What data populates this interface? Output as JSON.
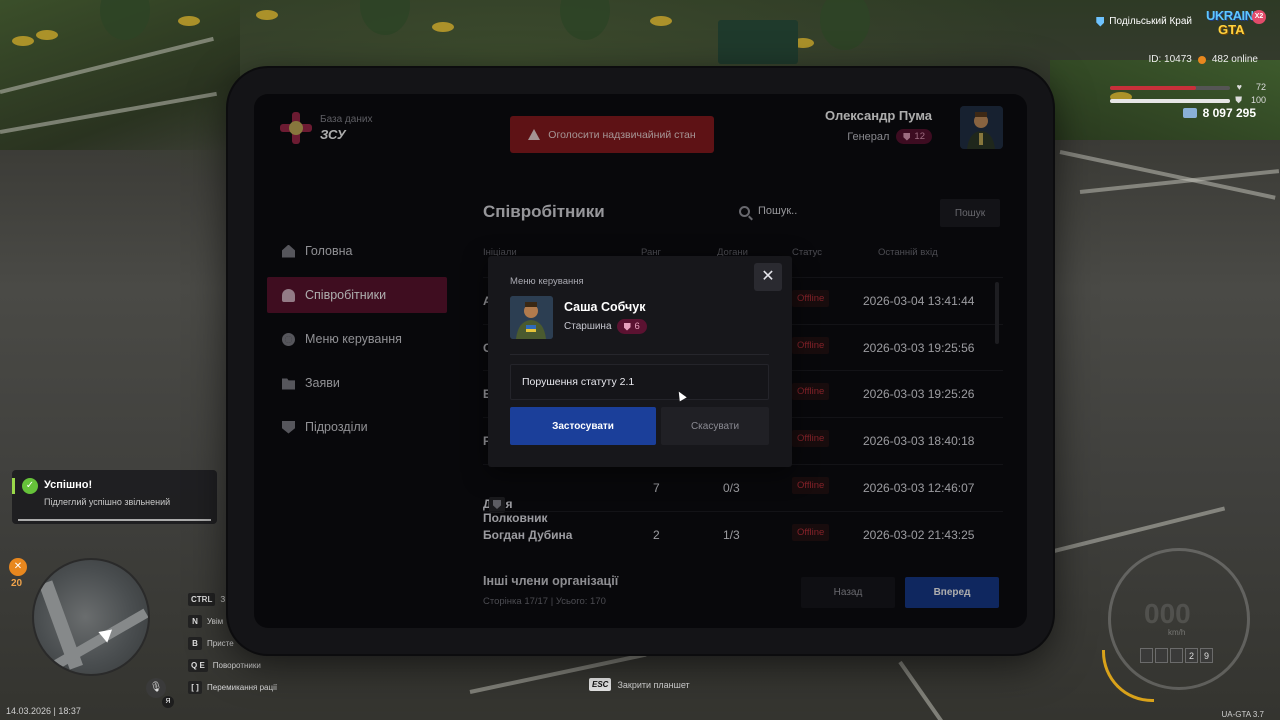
{
  "hud": {
    "region": "Подільський Край",
    "logo_line1": "UKRAINE",
    "logo_line2": "GTA",
    "logo_badge": "X2",
    "player_id": "ID: 10473",
    "online": "482 online",
    "health": 72,
    "armor": 100,
    "money": "8 097 295",
    "hunger": "20",
    "mic_key": "Я",
    "datetime": "14.03.2026 | 18:37",
    "version": "UA-GTA 3.7",
    "speed_unit": "km/h",
    "odometer": [
      "",
      "",
      "",
      "2",
      "9"
    ],
    "esc_key": "ESC",
    "esc_label": "Закрити планшет",
    "keys": [
      {
        "key": "CTRL",
        "label": "З"
      },
      {
        "key": "N",
        "label": "Увім"
      },
      {
        "key": "B",
        "label": "Присте"
      },
      {
        "key": "Q E",
        "label": "Поворотники"
      },
      {
        "key": "[ ]",
        "label": "Перемикання рації"
      }
    ]
  },
  "toast": {
    "title": "Успішно!",
    "message": "Підлеглий успішно звільнений"
  },
  "tablet": {
    "brand_line1": "База даних",
    "brand_line2": "ЗСУ",
    "emergency_label": "Оголосити надзвичайний стан",
    "user": {
      "name": "Олександр Пума",
      "rank": "Генерал",
      "level": "12"
    },
    "nav": [
      {
        "label": "Головна",
        "icon": "home-icon",
        "active": false
      },
      {
        "label": "Співробітники",
        "icon": "users-icon",
        "active": true
      },
      {
        "label": "Меню керування",
        "icon": "gear-icon",
        "active": false
      },
      {
        "label": "Заяви",
        "icon": "folder-icon",
        "active": false
      },
      {
        "label": "Підрозділи",
        "icon": "shield-icon",
        "active": false
      }
    ],
    "section_title": "Співробітники",
    "search_placeholder": "Пошук..",
    "search_button": "Пошук",
    "columns": [
      "Ініціали",
      "Ранг",
      "Догани",
      "Статус",
      "Останній вхід"
    ],
    "rows": [
      {
        "name": "А",
        "rank": "",
        "warns": "",
        "status": "Offline",
        "last": "2026-03-04 13:41:44"
      },
      {
        "name": "С",
        "rank": "",
        "warns": "",
        "status": "Offline",
        "last": "2026-03-03 19:25:56"
      },
      {
        "name": "Е",
        "rank": "",
        "warns": "",
        "status": "Offline",
        "last": "2026-03-03 19:25:26"
      },
      {
        "name": "Р",
        "rank": "",
        "warns": "",
        "status": "Offline",
        "last": "2026-03-03 18:40:18"
      },
      {
        "name": "Даня Полковник",
        "rank": "7",
        "warns": "0/3",
        "status": "Offline",
        "last": "2026-03-03 12:46:07"
      },
      {
        "name": "Богдан Дубина",
        "rank": "2",
        "warns": "1/3",
        "status": "Offline",
        "last": "2026-03-02 21:43:25"
      }
    ],
    "footer_title": "Інші члени організації",
    "footer_sub": "Сторінка 17/17 | Усього: 170",
    "prev_label": "Назад",
    "next_label": "Вперед"
  },
  "modal": {
    "title": "Меню керування",
    "close_glyph": "✕",
    "member_name": "Саша Собчук",
    "member_rank": "Старшина",
    "member_level": "6",
    "reason_value": "Порушення статуту 2.1",
    "apply_label": "Застосувати",
    "cancel_label": "Скасувати"
  }
}
